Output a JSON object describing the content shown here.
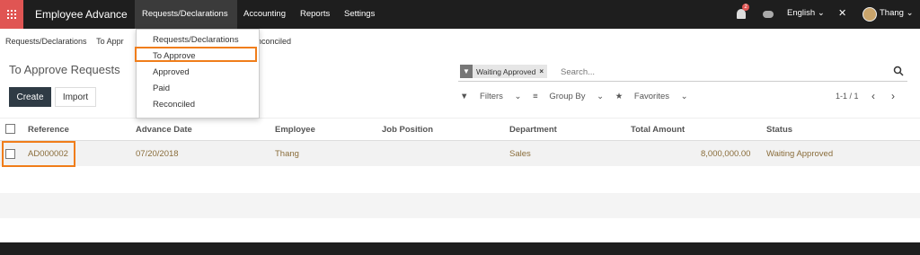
{
  "topbar": {
    "brand": "Employee Advance",
    "menu": [
      "Requests/Declarations",
      "Accounting",
      "Reports",
      "Settings"
    ],
    "notification_count": "2",
    "language": "English",
    "language_caret": "⌄",
    "close_glyph": "✕",
    "user": "Thang",
    "user_caret": "⌄"
  },
  "breadcrumb": {
    "first": "Requests/Declarations",
    "second_partial": "To Appr",
    "third_partial": "nconciled"
  },
  "page": {
    "title": "To Approve Requests",
    "create_label": "Create",
    "import_label": "Import"
  },
  "search": {
    "facet_label": "Waiting Approved",
    "facet_close": "×",
    "placeholder": "Search..."
  },
  "filters": {
    "filters_label": "Filters",
    "groupby_label": "Group By",
    "favorites_label": "Favorites"
  },
  "pager": {
    "text": "1-1 / 1",
    "prev": "‹",
    "next": "›"
  },
  "dropdown": {
    "items": [
      "Requests/Declarations",
      "To Approve",
      "Approved",
      "Paid",
      "Reconciled"
    ]
  },
  "table": {
    "headers": [
      "Reference",
      "Advance Date",
      "Employee",
      "Job Position",
      "Department",
      "Total Amount",
      "Status"
    ],
    "rows": [
      {
        "reference": "AD000002",
        "advance_date": "07/20/2018",
        "employee": "Thang",
        "job_position": "",
        "department": "Sales",
        "total_amount": "8,000,000.00",
        "status": "Waiting Approved"
      }
    ]
  },
  "colors": {
    "topbar_bg": "#1e1e1e",
    "apps_bg": "#e05553",
    "highlight": "#f07d1a",
    "row_text": "#8a6d3b"
  },
  "icons": [
    "apps-grid-icon",
    "bell-icon",
    "chat-icon",
    "close-icon",
    "avatar",
    "filter-icon",
    "search-icon",
    "list-icon",
    "star-icon",
    "chevron-left-icon",
    "chevron-right-icon"
  ]
}
